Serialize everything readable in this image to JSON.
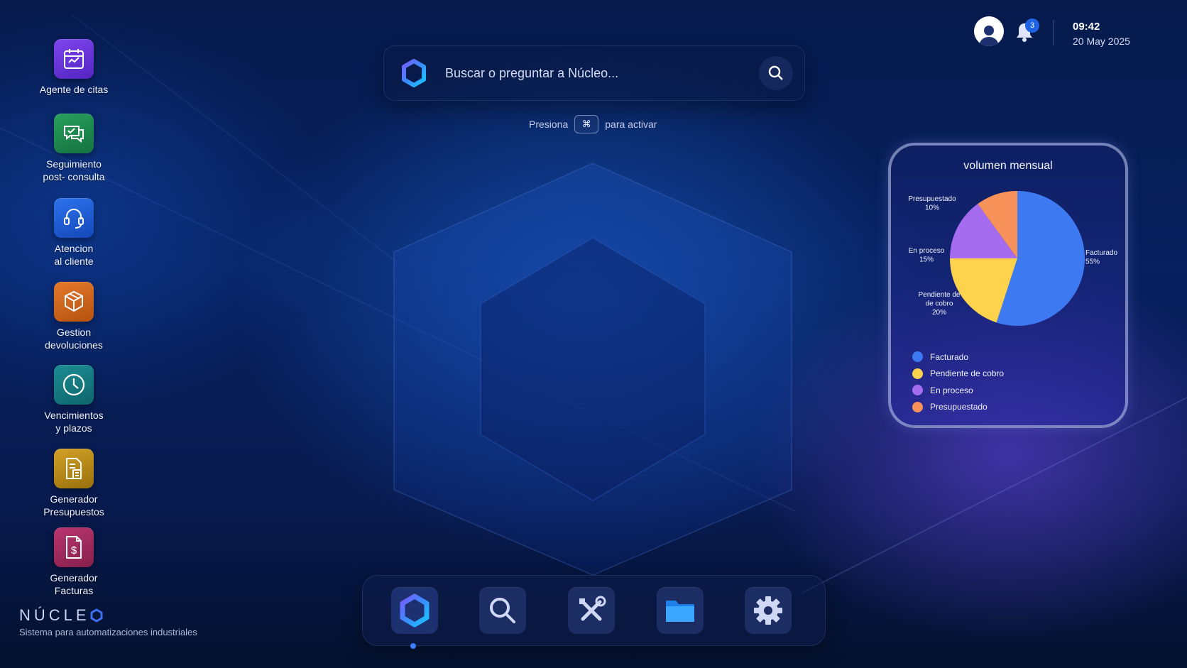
{
  "desktop_apps": [
    {
      "label": "Agente de citas",
      "icon": "calendar-icon",
      "color": "#6a35d8"
    },
    {
      "label": "Seguimiento\npost- consulta",
      "icon": "chat-check-icon",
      "color": "#1f8a4e"
    },
    {
      "label": "Atencion\nal cliente",
      "icon": "headset-icon",
      "color": "#1f5fd6"
    },
    {
      "label": "Gestion\ndevoluciones",
      "icon": "box-icon",
      "color": "#d0681e"
    },
    {
      "label": "Vencimientos\ny plazos",
      "icon": "clock-icon",
      "color": "#137a80"
    },
    {
      "label": "Generador\nPresupuestos",
      "icon": "calculator-doc-icon",
      "color": "#b88a14"
    },
    {
      "label": "Generador\nFacturas",
      "icon": "invoice-icon",
      "color": "#a12a5e"
    }
  ],
  "brand": {
    "name": "NÚCLE",
    "tagline": "Sistema para automatizaciones industriales"
  },
  "search": {
    "placeholder": "Buscar o preguntar a Núcleo..."
  },
  "hint": {
    "before": "Presiona",
    "key": "⌘",
    "after": "para activar"
  },
  "header": {
    "notifications": "3",
    "time": "09:42",
    "date": "20 May 2025"
  },
  "widget": {
    "title": "volumen mensual"
  },
  "chart_data": {
    "type": "pie",
    "title": "volumen mensual",
    "slices": [
      {
        "name": "Facturado",
        "value": 55,
        "label_lines": [
          "Facturado",
          "55%"
        ],
        "color": "#3d7af2"
      },
      {
        "name": "Pendiente de cobro",
        "value": 20,
        "label_lines": [
          "Pendiente de",
          "de cobro",
          "20%"
        ],
        "color": "#fdd34d"
      },
      {
        "name": "En proceso",
        "value": 15,
        "label_lines": [
          "En proceso",
          "15%"
        ],
        "color": "#a66cf0"
      },
      {
        "name": "Presupuestado",
        "value": 10,
        "label_lines": [
          "Presupuestado",
          "10%"
        ],
        "color": "#f7925a"
      }
    ],
    "legend": [
      "Facturado",
      "Pendiente de cobro",
      "En proceso",
      "Presupuestado"
    ]
  },
  "dock": {
    "items": [
      {
        "name": "nucleo-home",
        "icon": "hexagon-logo-icon",
        "active": true
      },
      {
        "name": "search",
        "icon": "search-icon"
      },
      {
        "name": "tools",
        "icon": "tools-icon"
      },
      {
        "name": "files",
        "icon": "folder-icon"
      },
      {
        "name": "settings",
        "icon": "gear-icon"
      }
    ]
  }
}
